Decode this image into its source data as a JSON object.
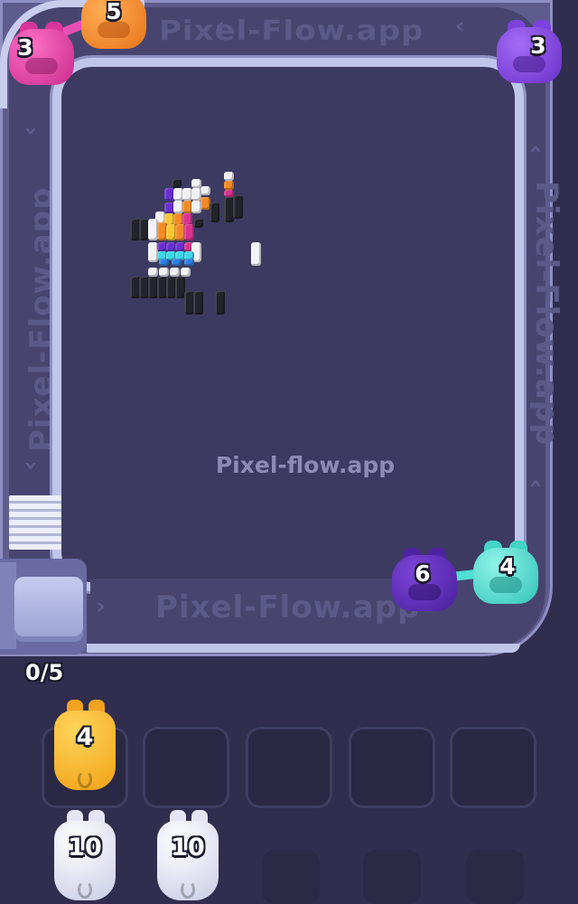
{
  "watermark_text": "Pixel-flow.app",
  "lane_watermarks": {
    "top": "Pixel-Flow.app",
    "right": "Pixel-Flow.app",
    "left": "Pixel-Flow.app",
    "bottom": "Pixel-Flow.app"
  },
  "colors": {
    "background": "#302d4e",
    "board": "#3c3a61",
    "track": "#47456f",
    "rail": "#bfc6ea",
    "magenta": "#e33fa9",
    "orange": "#f58a2a",
    "purple": "#7a3fd6",
    "dark_purple": "#5a2bb0",
    "cyan": "#4fe0d4",
    "yellow": "#f7b52c",
    "white": "#f1f2fb"
  },
  "track_shooters": [
    {
      "name": "magenta-pig",
      "count": "3",
      "color": "magenta",
      "icon": "pig-icon"
    },
    {
      "name": "orange-pig",
      "count": "5",
      "color": "orange",
      "icon": "pig-icon"
    },
    {
      "name": "purple-pig",
      "count": "3",
      "color": "purple",
      "icon": "pig-icon"
    },
    {
      "name": "dark-purple-pig",
      "count": "6",
      "color": "dark_purple",
      "icon": "pig-icon"
    },
    {
      "name": "cyan-pig",
      "count": "4",
      "color": "cyan",
      "icon": "pig-icon"
    }
  ],
  "slots_progress": "0/5",
  "slots": [
    {
      "name": "slot-1",
      "count": "4",
      "color": "yellow"
    },
    {
      "name": "slot-2"
    },
    {
      "name": "slot-3"
    },
    {
      "name": "slot-4"
    },
    {
      "name": "slot-5"
    }
  ],
  "queue": [
    {
      "name": "queue-pig-1",
      "count": "10",
      "color": "white"
    },
    {
      "name": "queue-pig-2",
      "count": "10",
      "color": "white"
    }
  ],
  "pixel_art_palette": [
    "black",
    "white",
    "gray",
    "purple",
    "magenta",
    "orange",
    "yellow",
    "cyan"
  ]
}
